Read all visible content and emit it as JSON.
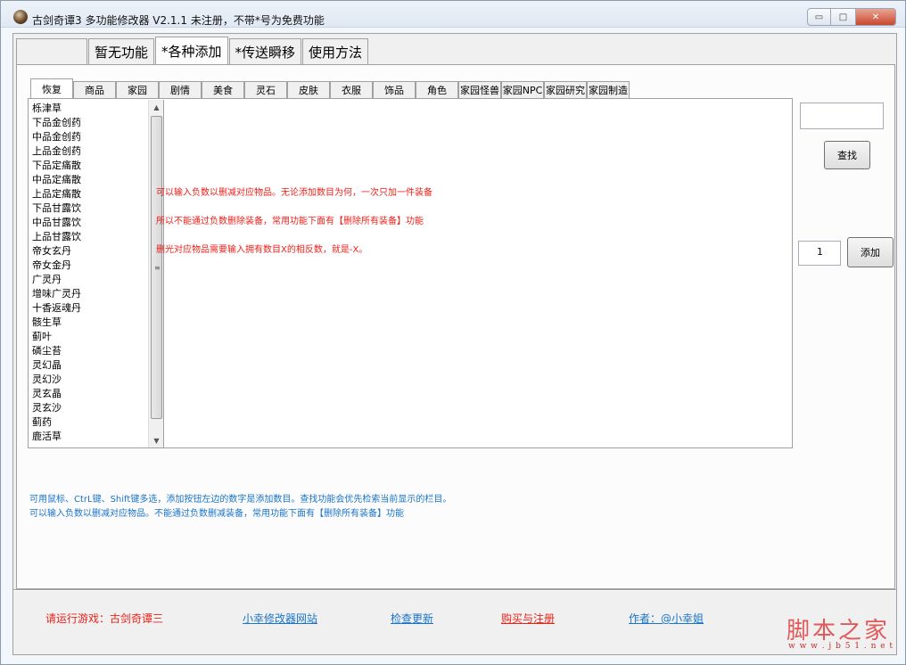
{
  "window": {
    "title": "古剑奇谭3 多功能修改器  V2.1.1 未注册，不带*号为免费功能",
    "min_glyph": "▭",
    "max_glyph": "□",
    "close_glyph": "✕"
  },
  "outer_tabs": [
    "",
    "暂无功能",
    "*各种添加",
    "*传送瞬移",
    "使用方法"
  ],
  "outer_active_index": 2,
  "inner_tabs": [
    "恢复",
    "商品",
    "家园",
    "剧情",
    "美食",
    "灵石",
    "皮肤",
    "衣服",
    "饰品",
    "角色",
    "家园怪兽",
    "家园NPC",
    "家园研究",
    "家园制造"
  ],
  "inner_active_index": 0,
  "item_list": [
    "栎津草",
    "下品金创药",
    "中品金创药",
    "上品金创药",
    "下品定痛散",
    "中品定痛散",
    "上品定痛散",
    "下品甘露饮",
    "中品甘露饮",
    "上品甘露饮",
    "帝女玄丹",
    "帝女金丹",
    "广灵丹",
    "增味广灵丹",
    "十香返魂丹",
    "骸生草",
    "蓟叶",
    "磷尘苔",
    "灵幻晶",
    "灵幻沙",
    "灵玄晶",
    "灵玄沙",
    "蓟药",
    "鹿活草"
  ],
  "scrollbar": {
    "up": "▲",
    "down": "▼",
    "grip": "≡"
  },
  "notes": [
    "可以输入负数以删减对应物品。无论添加数目为何，一次只加一件装备",
    "所以不能通过负数删除装备，常用功能下面有【删除所有装备】功能",
    "删光对应物品需要输入拥有数目X的相反数，就是-X。"
  ],
  "search": {
    "value": "",
    "button": "查找"
  },
  "add": {
    "quantity": "1",
    "button": "添加"
  },
  "hints": [
    "可用鼠标、CtrL键、Shift键多选，添加按钮左边的数字是添加数目。查找功能会优先检索当前显示的栏目。",
    "可以输入负数以删减对应物品。不能通过负数删减装备，常用功能下面有【删除所有装备】功能"
  ],
  "footer": {
    "run_game": "请运行游戏：古剑奇谭三",
    "website": "小幸修改器网站",
    "check_update": "检查更新",
    "buy_register": "购买与注册",
    "author": "作者：@小幸姐"
  },
  "watermark": {
    "big": "脚本之家",
    "small": "w w w . j b 5 1 . n e t"
  },
  "colors": {
    "note_red": "#e8221b",
    "hint_blue": "#1a74c8"
  }
}
